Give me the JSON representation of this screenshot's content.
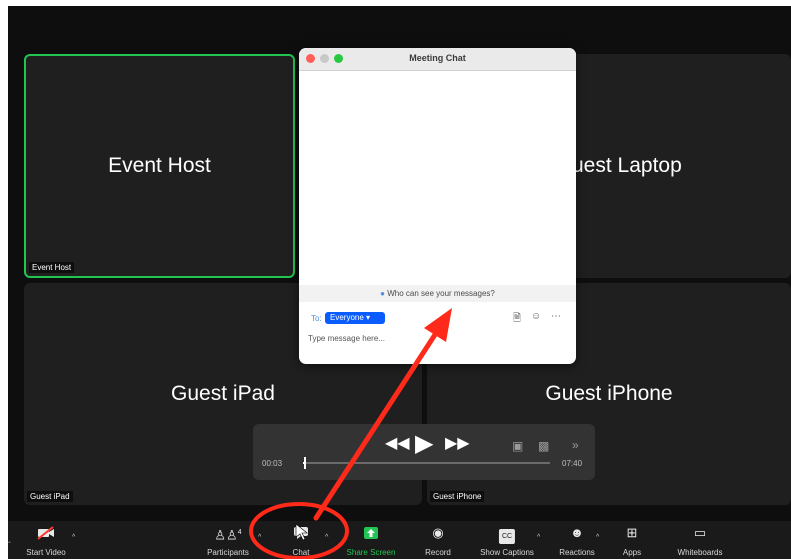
{
  "tiles": [
    {
      "name": "Event Host",
      "label": "Event Host"
    },
    {
      "name": "Guest Laptop",
      "label": ""
    },
    {
      "name": "Guest iPad",
      "label": "Guest iPad"
    },
    {
      "name": "Guest iPhone",
      "label": "Guest iPhone"
    }
  ],
  "visible_names": {
    "laptop_partial": "uest Laptop"
  },
  "player": {
    "elapsed": "00:03",
    "remaining": "07:40",
    "progress_fraction": 0.01
  },
  "chat": {
    "title": "Meeting Chat",
    "who_can_see": "Who can see your messages?",
    "to_label": "To:",
    "recipient": "Everyone",
    "placeholder": "Type message here..."
  },
  "toolbar": {
    "items": [
      {
        "label": "Start Video",
        "icon": "video-off-icon"
      },
      {
        "label": "Participants",
        "icon": "participants-icon",
        "count": "4"
      },
      {
        "label": "Chat",
        "icon": "chat-bubble-icon"
      },
      {
        "label": "Share Screen",
        "icon": "share-screen-icon"
      },
      {
        "label": "Record",
        "icon": "record-icon"
      },
      {
        "label": "Show Captions",
        "icon": "cc-icon"
      },
      {
        "label": "Reactions",
        "icon": "emoji-icon"
      },
      {
        "label": "Apps",
        "icon": "apps-icon"
      },
      {
        "label": "Whiteboards",
        "icon": "whiteboard-icon"
      }
    ]
  },
  "colors": {
    "active_border": "#23c552",
    "share_green": "#23c552",
    "chat_blue": "#0b5cff",
    "annotation_red": "#ff2a1a",
    "background": "#0e0e0e",
    "tile": "#1f1f1f"
  }
}
